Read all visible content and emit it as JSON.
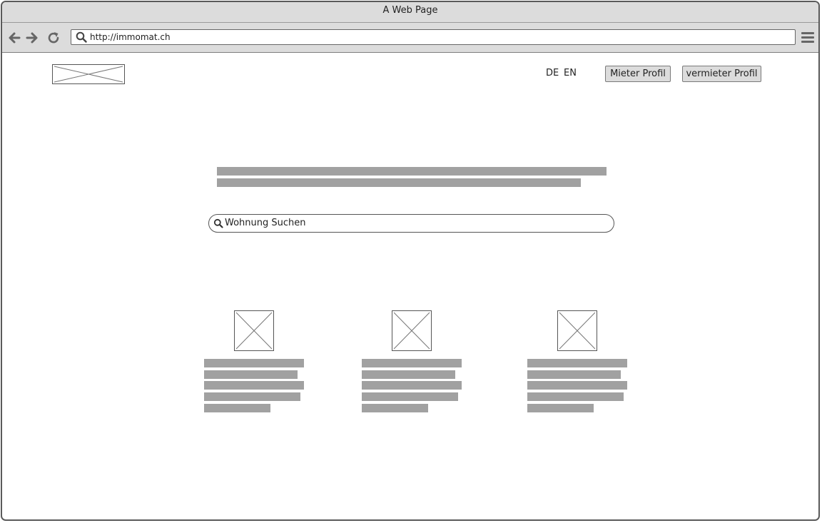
{
  "window": {
    "title": "A Web Page"
  },
  "browser": {
    "url": "http://immomat.ch"
  },
  "header": {
    "lang_de": "DE",
    "lang_en": "EN",
    "tenant_button": "Mieter Profil",
    "landlord_button": "vermieter Profil"
  },
  "search": {
    "placeholder": "Wohnung Suchen"
  },
  "colors": {
    "chrome": "#dcdcdc",
    "placeholder_bar": "#a1a1a1",
    "border": "#5a5a5a"
  },
  "icons": [
    "back-arrow-icon",
    "forward-arrow-icon",
    "reload-icon",
    "search-icon",
    "hamburger-menu-icon",
    "image-placeholder-icon"
  ]
}
